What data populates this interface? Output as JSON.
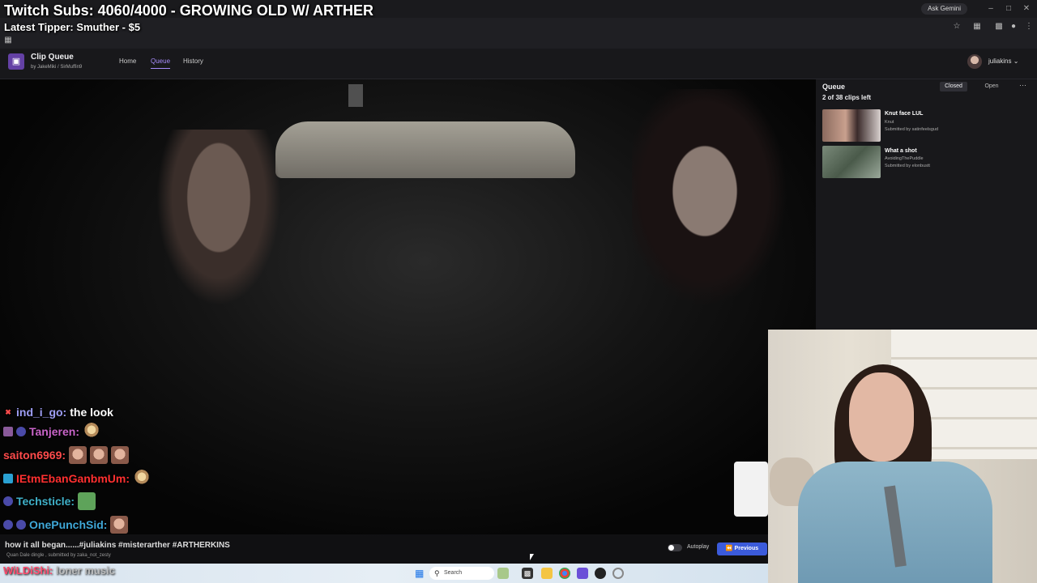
{
  "browser": {
    "ask_gemini": "Ask Gemini",
    "icons": [
      "star-icon",
      "extension-icon",
      "puzzle-icon",
      "profile-icon",
      "menu-icon"
    ]
  },
  "overlay": {
    "sub_goal": "Twitch Subs: 4060/4000 - GROWING OLD W/ ARTHER",
    "latest_tipper": "Latest Tipper: Smuther - $5"
  },
  "app": {
    "title": "Clip Queue",
    "byline": "by JakeMiki / SirMuffin9",
    "nav": {
      "home": "Home",
      "queue": "Queue",
      "history": "History"
    },
    "user": "juliakins"
  },
  "queue": {
    "title": "Queue",
    "count": "2 of 38 clips left",
    "closed_label": "Closed",
    "open_label": "Open",
    "clips": [
      {
        "title": "Knut face LUL",
        "channel": "Knut",
        "submitted_by": "Submitted by satinfeelsgud"
      },
      {
        "title": "What a shot",
        "channel": "AvoidingThePuddle",
        "submitted_by": "Submitted by elonbustt"
      }
    ]
  },
  "chat": [
    {
      "user": "ind_i_go:",
      "message": "the look",
      "user_color": "#9e9ef5",
      "msg_color": "#ffffff",
      "badge_color": "#ff4b4b"
    },
    {
      "user": "Tanjeren:",
      "message": "",
      "user_color": "#c864c8",
      "msg_color": "#ffffff",
      "badge_color": "#8a5a9a"
    },
    {
      "user": "saiton6969:",
      "message": "",
      "user_color": "#ff4b4b",
      "msg_color": "#ffffff",
      "badge_color": ""
    },
    {
      "user": "IEtmEbanGanbmUm:",
      "message": "",
      "user_color": "#ff3030",
      "msg_color": "#ffffff",
      "badge_color": "#2aa1d3"
    },
    {
      "user": "Techsticle:",
      "message": "",
      "user_color": "#3fb0c8",
      "msg_color": "#ffffff",
      "badge_color": "#4a4aa8"
    },
    {
      "user": "OnePunchSid:",
      "message": "",
      "user_color": "#3fa8d8",
      "msg_color": "#ffffff",
      "badge_color": "#4a4aa8"
    }
  ],
  "bottom": {
    "title": "how it all began......#juliakins #misterarther #ARTHERKINS",
    "subtitle": "Quan Dale dingle , submitted by zaka_not_zesty",
    "autoplay_label": "Autoplay",
    "previous_label": "Previous"
  },
  "last_chat": {
    "user": "WiLDiShi:",
    "message": "loner music"
  },
  "taskbar": {
    "search_placeholder": "Search"
  }
}
